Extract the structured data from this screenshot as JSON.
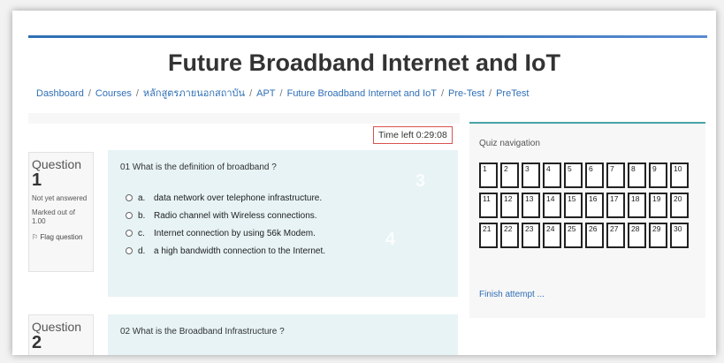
{
  "page": {
    "title": "Future Broadband Internet and IoT"
  },
  "breadcrumb": [
    "Dashboard",
    "Courses",
    "หลักสูตรภายนอกสถาบัน",
    "APT",
    "Future Broadband Internet and IoT",
    "Pre-Test",
    "PreTest"
  ],
  "timer": "Time left 0:29:08",
  "questions": [
    {
      "label": "Question",
      "number": "1",
      "status": "Not yet answered",
      "marks": "Marked out of 1.00",
      "flag": "Flag question",
      "text": "01 What is the definition of broadband ?",
      "answers": [
        {
          "letter": "a.",
          "text": "data network over telephone infrastructure."
        },
        {
          "letter": "b.",
          "text": "Radio channel with Wireless connections."
        },
        {
          "letter": "c.",
          "text": "Internet connection by using 56k Modem."
        },
        {
          "letter": "d.",
          "text": "a high bandwidth connection to the Internet."
        }
      ],
      "marks_shown": [
        "3",
        "4"
      ]
    },
    {
      "label": "Question",
      "number": "2",
      "text": "02 What is the Broadband Infrastructure ?"
    }
  ],
  "quiz_nav": {
    "title": "Quiz navigation",
    "buttons": [
      "1",
      "2",
      "3",
      "4",
      "5",
      "6",
      "7",
      "8",
      "9",
      "10",
      "11",
      "12",
      "13",
      "14",
      "15",
      "16",
      "17",
      "18",
      "19",
      "20",
      "21",
      "22",
      "23",
      "24",
      "25",
      "26",
      "27",
      "28",
      "29",
      "30"
    ],
    "finish": "Finish attempt ..."
  },
  "colors": {
    "accent": "#2f6fb6",
    "question_bg": "#e7f3f5",
    "timer_border": "#d9534f",
    "nav_border_top": "#4aa3a6"
  }
}
